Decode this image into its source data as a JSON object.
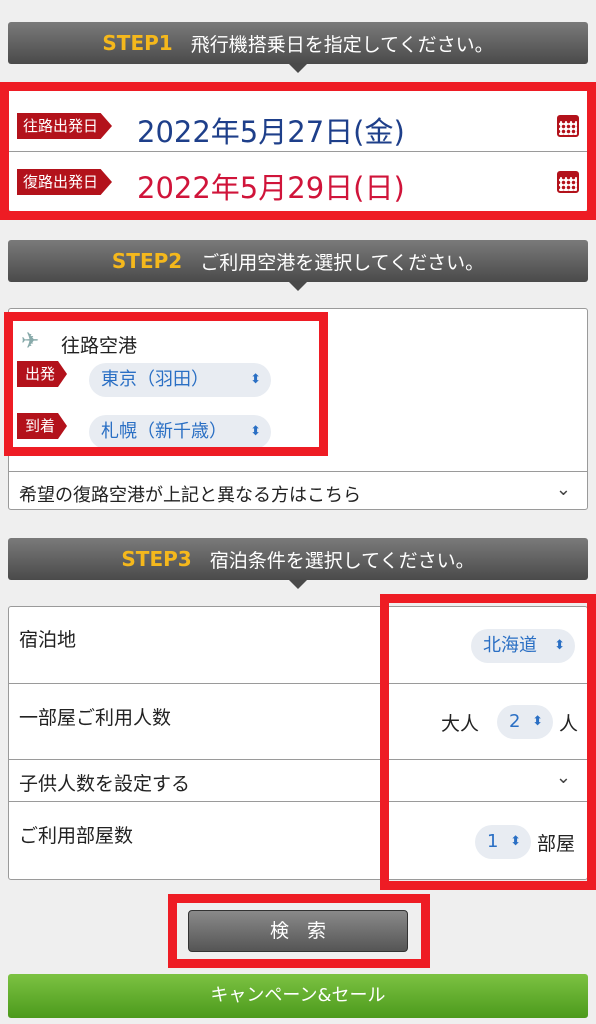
{
  "step1": {
    "num": "STEP1",
    "title": "飛行機搭乗日を指定してください。"
  },
  "outbound": {
    "tag": "往路出発日",
    "date": "2022年5月27日(金)",
    "color": "#1e3f8a"
  },
  "return": {
    "tag": "復路出発日",
    "date": "2022年5月29日(日)",
    "color": "#d0143a"
  },
  "step2": {
    "num": "STEP2",
    "title": "ご利用空港を選択してください。"
  },
  "airport": {
    "heading": "往路空港",
    "depart_tag": "出発",
    "depart_value": "東京（羽田）",
    "arrive_tag": "到着",
    "arrive_value": "札幌（新千歳）",
    "return_link": "希望の復路空港が上記と異なる方はこちら"
  },
  "step3": {
    "num": "STEP3",
    "title": "宿泊条件を選択してください。"
  },
  "stay": {
    "place_label": "宿泊地",
    "place_value": "北海道",
    "people_label": "一部屋ご利用人数",
    "adult_prefix": "大人",
    "adult_value": "2",
    "adult_suffix": "人",
    "children_label": "子供人数を設定する",
    "rooms_label": "ご利用部屋数",
    "rooms_value": "1",
    "rooms_suffix": "部屋"
  },
  "search_label": "検索",
  "campaign_label": "キャンペーン&セール",
  "icons": {
    "updown": "⌃⌄",
    "chevron": "chevron-down-icon",
    "calendar": "calendar-icon",
    "plane": "airplane-icon"
  }
}
